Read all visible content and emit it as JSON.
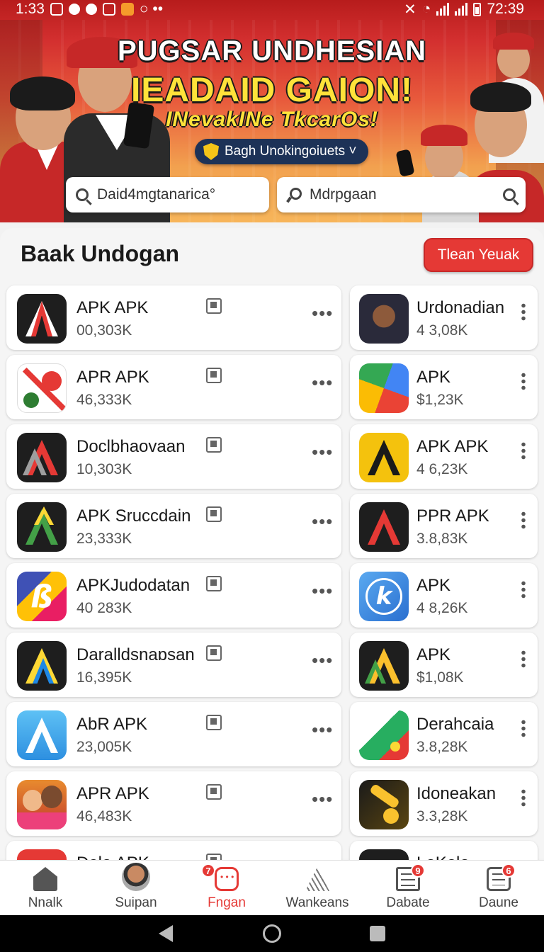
{
  "status_bar": {
    "time_left": "1:33",
    "time_right": "72:39"
  },
  "banner": {
    "line1": "PUGSAR UNDHESIAN",
    "line2": "IEADAID GAION!",
    "line3": "INevakINe TkcarOs!",
    "pill_label": "Bagh Unokingoiuets ˅"
  },
  "search": {
    "left_text": "Daid4mgtanarica°",
    "right_text": "Mdrpgaan"
  },
  "section": {
    "title": "Baak Undogan",
    "button_label": "Tlean Yeuak"
  },
  "apps_left": [
    {
      "name": "APK APK",
      "count": "00,303K",
      "icon": "apkpure-dark-icon"
    },
    {
      "name": "APR APK",
      "count": "46,333K",
      "icon": "no-youtube-icon"
    },
    {
      "name": "Doclbhaovaan",
      "count": "10,303K",
      "icon": "triangle-dark-icon"
    },
    {
      "name": "APK Sruccdain",
      "count": "23,333K",
      "icon": "triangle-green-icon"
    },
    {
      "name": "APKJudodatan",
      "count": "40 283K",
      "icon": "colorful-b-icon"
    },
    {
      "name": "Daralldsnaɒsan",
      "count": "16,395K",
      "icon": "triangle-yellow-icon"
    },
    {
      "name": "AbR APK",
      "count": "23,005K",
      "icon": "app-store-icon"
    },
    {
      "name": "APR APK",
      "count": "46,483K",
      "icon": "cartoon-family-icon"
    }
  ],
  "apps_right": [
    {
      "name": "Urdonadian",
      "count": "4 3,08K",
      "icon": "portrait-icon"
    },
    {
      "name": "APK",
      "count": "$1,23K",
      "icon": "play-store-icon"
    },
    {
      "name": "APK APK",
      "count": "4 6,23K",
      "icon": "triangle-yellow-badge-icon"
    },
    {
      "name": "PPR APK",
      "count": "3.8,83K",
      "icon": "triangle-red-icon"
    },
    {
      "name": "APK",
      "count": "4 8,26K",
      "icon": "k-blue-icon"
    },
    {
      "name": "APK",
      "count": "$1,08K",
      "icon": "triangle-gold-icon"
    },
    {
      "name": "Derahcaia",
      "count": "3.8,28K",
      "icon": "green-red-stripe-icon"
    },
    {
      "name": "Idoneakan",
      "count": "3.3,28K",
      "icon": "golden-key-icon"
    }
  ],
  "partial_row": {
    "left_name": "Dalo APK",
    "right_name": "LoKolo"
  },
  "bottom_nav": [
    {
      "label": "Nnalk",
      "badge": ""
    },
    {
      "label": "Suipan",
      "badge": ""
    },
    {
      "label": "Fngan",
      "badge": "7"
    },
    {
      "label": "Wankeans",
      "badge": ""
    },
    {
      "label": "Dabate",
      "badge": "9"
    },
    {
      "label": "Daune",
      "badge": "6"
    }
  ],
  "colors": {
    "accent": "#e53935",
    "banner_title": "#ffe23a",
    "pill": "#1d3257"
  }
}
